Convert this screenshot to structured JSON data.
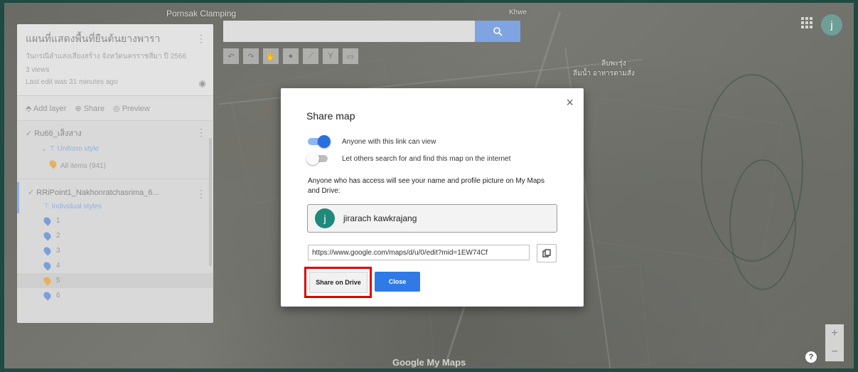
{
  "map": {
    "labels": [
      "Pornsak Clamping",
      "Khwe",
      "ลีบพะรุ่ง",
      "ลีมน้ำ อาหารตามสั่ง"
    ],
    "brand": "Google My Maps"
  },
  "panel": {
    "title": "แผนที่แสดงพื้นที่ยืนต้นยางพารา",
    "subtitle": "วันกรณีลำแสงเสียงสร้าง จังหวัดนครราชสีมา ปี 2566",
    "views": "3 views",
    "last_edit": "Last edit was 31 minutes ago",
    "actions": {
      "add_layer": "Add layer",
      "share": "Share",
      "preview": "Preview"
    },
    "layers": [
      {
        "name": "Ru66_เส็งสาง",
        "style": "Uniform style",
        "all_items": "All items (941)"
      },
      {
        "name": "RRiPoint1_Nakhonratchasrima_6...",
        "style": "Individual styles"
      }
    ],
    "points": [
      "1",
      "2",
      "3",
      "4",
      "5",
      "6"
    ]
  },
  "dialog": {
    "title": "Share map",
    "close_icon": "×",
    "option_link": "Anyone with this link can view",
    "option_search": "Let others search for and find this map on the internet",
    "notice": "Anyone who has access will see your name and profile picture on My Maps and Drive:",
    "owner_initial": "j",
    "owner_name": "jirarach kawkrajang",
    "link": "https://www.google.com/maps/d/u/0/edit?mid=1EW74Cf",
    "share_on_drive": "Share on Drive",
    "close_label": "Close"
  },
  "user": {
    "initial": "j"
  },
  "controls": {
    "zoom_in": "+",
    "zoom_out": "−",
    "help": "?"
  },
  "colors": {
    "accent": "#2f7ae5",
    "highlight": "#e00000",
    "avatar": "#1f8a7c"
  }
}
